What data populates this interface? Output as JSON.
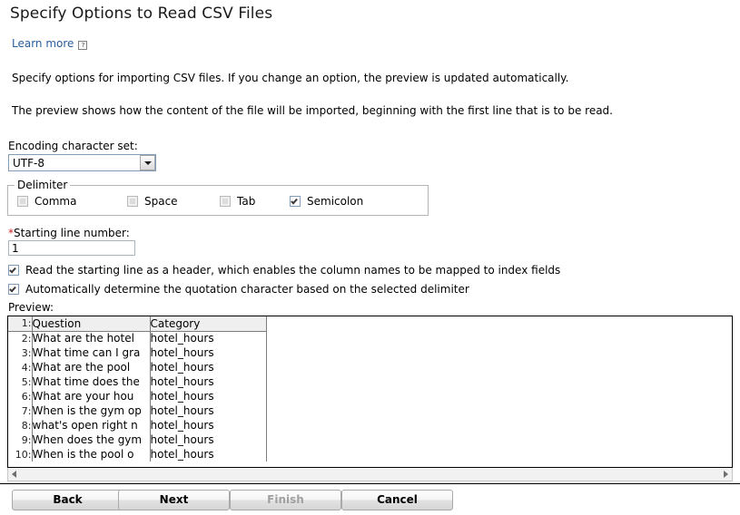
{
  "page": {
    "title": "Specify Options to Read CSV Files",
    "learn_more_label": "Learn more",
    "help_icon": "help-question-icon",
    "paragraph_1": "Specify options for importing CSV files. If you change an option, the preview is updated automatically.",
    "paragraph_2": "The preview shows how the content of the file will be imported, beginning with the first line that is to be read."
  },
  "encoding": {
    "label": "Encoding character set:",
    "value": "UTF-8",
    "arrow_icon": "chevron-down-icon"
  },
  "delimiter": {
    "legend": "Delimiter",
    "options": [
      {
        "label": "Comma",
        "checked": false
      },
      {
        "label": "Space",
        "checked": false
      },
      {
        "label": "Tab",
        "checked": false
      },
      {
        "label": "Semicolon",
        "checked": true
      }
    ]
  },
  "starting_line": {
    "required_marker": "*",
    "label": "Starting line number:",
    "value": "1"
  },
  "options": [
    {
      "label": "Read the starting line as a header, which enables the column names to be mapped to index fields",
      "checked": true
    },
    {
      "label": "Automatically determine the quotation character based on the selected delimiter",
      "checked": true
    }
  ],
  "preview": {
    "label": "Preview:",
    "columns": [
      "Question",
      "Category"
    ],
    "header_line_number": "1:",
    "rows": [
      {
        "n": "2:",
        "question": "What are the hotel",
        "category": "hotel_hours"
      },
      {
        "n": "3:",
        "question": "What time can I gra",
        "category": "hotel_hours"
      },
      {
        "n": "4:",
        "question": "What are the pool",
        "category": "hotel_hours"
      },
      {
        "n": "5:",
        "question": "What time does the",
        "category": "hotel_hours"
      },
      {
        "n": "6:",
        "question": "What are your hou",
        "category": "hotel_hours"
      },
      {
        "n": "7:",
        "question": "When is the gym op",
        "category": "hotel_hours"
      },
      {
        "n": "8:",
        "question": "what's open right n",
        "category": "hotel_hours"
      },
      {
        "n": "9:",
        "question": "When does the gym",
        "category": "hotel_hours"
      },
      {
        "n": "10:",
        "question": "When is the pool o",
        "category": "hotel_hours"
      }
    ],
    "scrollbar": {
      "left_arrow_icon": "triangle-left-icon",
      "right_arrow_icon": "triangle-right-icon"
    }
  },
  "footer": {
    "buttons": [
      {
        "label": "Back",
        "disabled": false
      },
      {
        "label": "Next",
        "disabled": false
      },
      {
        "label": "Finish",
        "disabled": true
      },
      {
        "label": "Cancel",
        "disabled": false
      }
    ]
  },
  "colors": {
    "link": "#2a5d9c",
    "required": "#cc2222",
    "disabled_text": "#a0a0a0",
    "header_row_bg": "#efefef"
  }
}
